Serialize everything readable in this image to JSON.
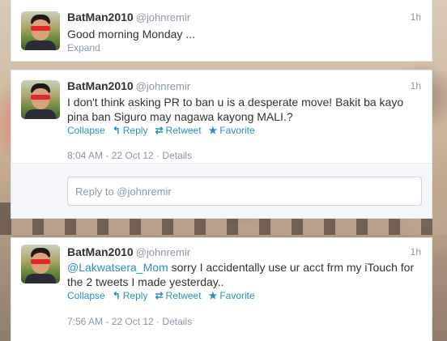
{
  "tweets": [
    {
      "name": "BatMan2010",
      "handle": "@johnremir",
      "time": "1h",
      "text": "Good morning Monday ...",
      "expand": "Expand"
    },
    {
      "name": "BatMan2010",
      "handle": "@johnremir",
      "time": "1h",
      "text_line1": "I don't think asking PR to ban u is a desperate move! Bakit ba kayo",
      "text_line2": "pina ban Siguro may nagawa kayong MALI.?",
      "actions": {
        "collapse": "Collapse",
        "reply": "Reply",
        "retweet": "Retweet",
        "favorite": "Favorite"
      },
      "date": "8:04 AM - 22 Oct 12",
      "details": "Details",
      "reply_placeholder": "Reply to @johnremir"
    },
    {
      "name": "BatMan2010",
      "handle": "@johnremir",
      "time": "1h",
      "mention": "@Lakwatsera_Mom",
      "text_line1": " sorry I accidentally use ur acct frm my iTouch for",
      "text_line2": "the 2 tweets I made yesterday..",
      "actions": {
        "collapse": "Collapse",
        "reply": "Reply",
        "retweet": "Retweet",
        "favorite": "Favorite"
      },
      "date": "7:56 AM - 22 Oct 12",
      "details": "Details"
    }
  ],
  "icons": {
    "reply": "reply-arrow-icon",
    "retweet": "retweet-icon",
    "favorite": "star-icon"
  }
}
